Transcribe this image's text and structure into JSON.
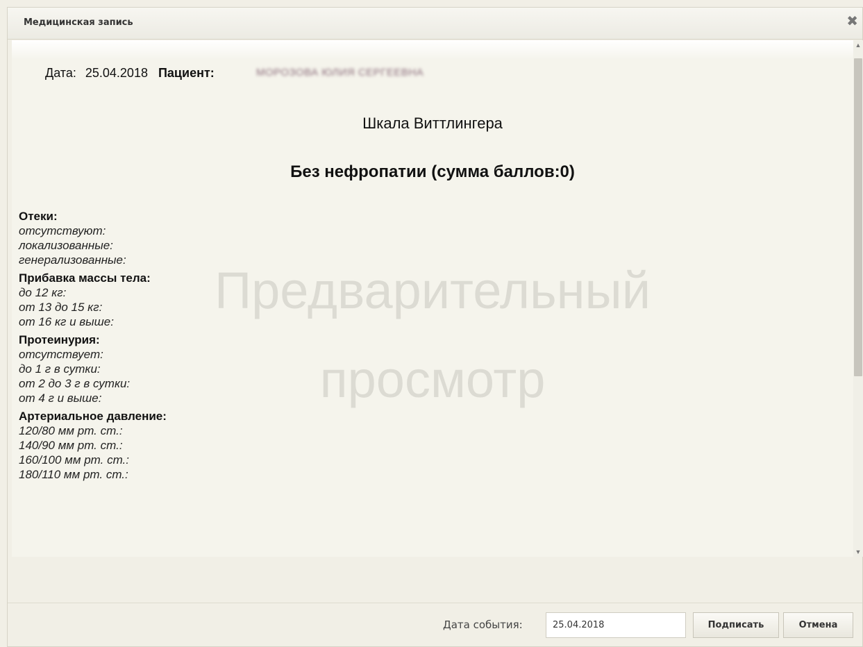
{
  "dialog": {
    "title": "Медицинская запись",
    "close_symbol": "✖"
  },
  "record": {
    "date_label": "Дата:",
    "date_value": "25.04.2018",
    "patient_label": "Пациент:",
    "patient_name": "МОРОЗОВА ЮЛИЯ СЕРГЕЕВНА",
    "scale_title": "Шкала Виттлингера",
    "result": "Без нефропатии (сумма баллов:0)"
  },
  "watermark": {
    "line1": "Предварительный",
    "line2": "просмотр"
  },
  "criteria": [
    {
      "title": "Отеки:",
      "items": [
        "отсутствуют:",
        "локализованные:",
        "генерализованные:"
      ]
    },
    {
      "title": "Прибавка массы тела:",
      "items": [
        "до 12 кг:",
        "от 13 до 15 кг:",
        "от 16 кг и выше:"
      ]
    },
    {
      "title": "Протеинурия:",
      "items": [
        "отсутствует:",
        "до 1 г в сутки:",
        "от 2 до 3 г в сутки:",
        "от 4 г и выше:"
      ]
    },
    {
      "title": "Артериальное давление:",
      "items": [
        "120/80 мм рт. ст.:",
        "140/90 мм рт. ст.:",
        "160/100 мм рт. ст.:",
        "180/110 мм рт. ст.:"
      ]
    }
  ],
  "footer": {
    "event_date_label": "Дата события:",
    "event_date_value": "25.04.2018",
    "sign_label": "Подписать",
    "cancel_label": "Отмена"
  }
}
